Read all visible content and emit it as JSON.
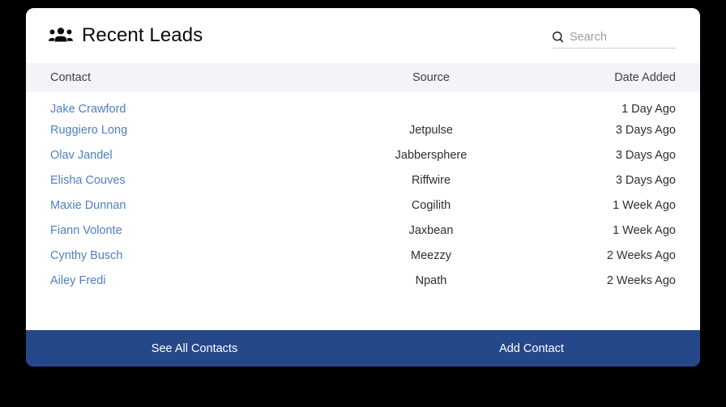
{
  "card": {
    "header": {
      "icon": "users-icon",
      "title": "Recent Leads",
      "search": {
        "icon": "search-icon",
        "placeholder": "Search",
        "value": ""
      },
      "scroll_indicator": "caret-up-icon"
    },
    "table": {
      "columns": [
        "Contact",
        "Source",
        "Date Added"
      ],
      "rows": [
        {
          "contact": "Jake Crawford",
          "source": "",
          "date": "1 Day Ago"
        },
        {
          "contact": "Ruggiero Long",
          "source": "Jetpulse",
          "date": "3 Days Ago"
        },
        {
          "contact": "Olav Jandel",
          "source": "Jabbersphere",
          "date": "3 Days Ago"
        },
        {
          "contact": "Elisha Couves",
          "source": "Riffwire",
          "date": "3 Days Ago"
        },
        {
          "contact": "Maxie Dunnan",
          "source": "Cogilith",
          "date": "1 Week Ago"
        },
        {
          "contact": "Fiann Volonte",
          "source": "Jaxbean",
          "date": "1 Week Ago"
        },
        {
          "contact": "Cynthy Busch",
          "source": "Meezzy",
          "date": "2 Weeks Ago"
        },
        {
          "contact": "Ailey Fredi",
          "source": "Npath",
          "date": "2 Weeks Ago"
        }
      ]
    },
    "footer": {
      "see_all_label": "See All Contacts",
      "add_contact_label": "Add Contact"
    },
    "colors": {
      "footer_background": "#25488a",
      "link": "#4e7fc1",
      "header_row_background": "#f4f4f8",
      "page_background": "#000000"
    }
  }
}
